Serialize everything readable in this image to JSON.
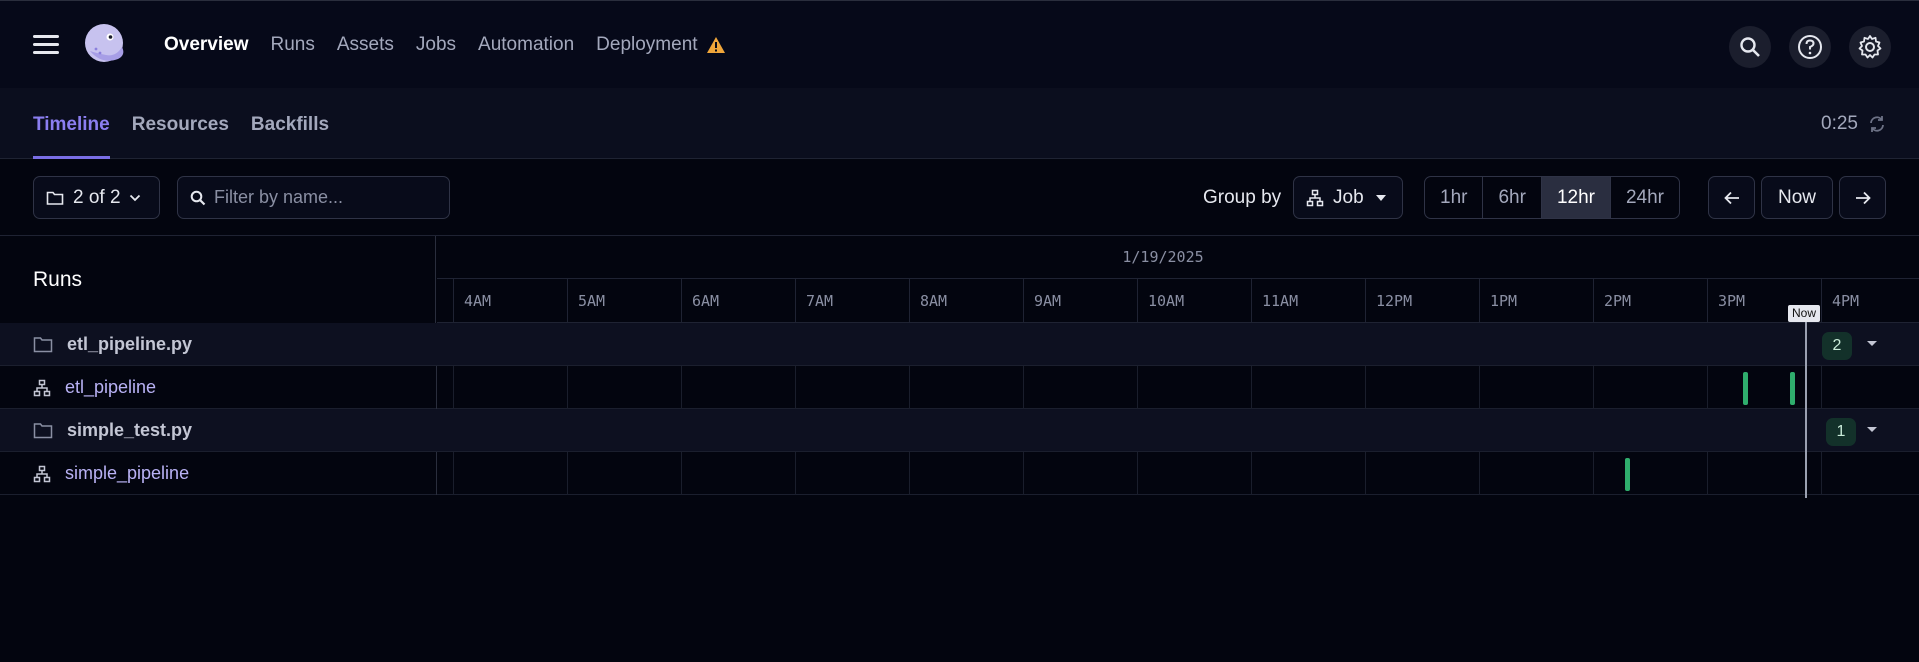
{
  "nav": {
    "links": [
      "Overview",
      "Runs",
      "Assets",
      "Jobs",
      "Automation",
      "Deployment"
    ],
    "active": "Overview",
    "deployment_warning_icon": "warning-icon",
    "right_icons": [
      "search-icon",
      "help-icon",
      "settings-icon"
    ]
  },
  "tabs": {
    "items": [
      "Timeline",
      "Resources",
      "Backfills"
    ],
    "active": "Timeline",
    "refresh_countdown": "0:25"
  },
  "toolbar": {
    "location_filter": "2 of 2",
    "search_placeholder": "Filter by name...",
    "group_by_label": "Group by",
    "group_by_value": "Job",
    "ranges": [
      "1hr",
      "6hr",
      "12hr",
      "24hr"
    ],
    "active_range": "12hr",
    "now_label": "Now"
  },
  "timeline": {
    "runs_title": "Runs",
    "date": "1/19/2025",
    "hours": [
      "4AM",
      "5AM",
      "6AM",
      "7AM",
      "8AM",
      "9AM",
      "10AM",
      "11AM",
      "12PM",
      "1PM",
      "2PM",
      "3PM",
      "4PM"
    ],
    "now_marker": "Now",
    "groups": [
      {
        "name": "etl_pipeline.py",
        "count": "2",
        "jobs": [
          {
            "name": "etl_pipeline",
            "run_times": [
              "3:19PM",
              "3:44PM"
            ]
          }
        ]
      },
      {
        "name": "simple_test.py",
        "count": "1",
        "jobs": [
          {
            "name": "simple_pipeline",
            "run_times": [
              "2:17PM"
            ]
          }
        ]
      }
    ]
  },
  "colors": {
    "accent": "#7a6ee6",
    "run_success": "#2fae6d",
    "background": "#03050f"
  }
}
